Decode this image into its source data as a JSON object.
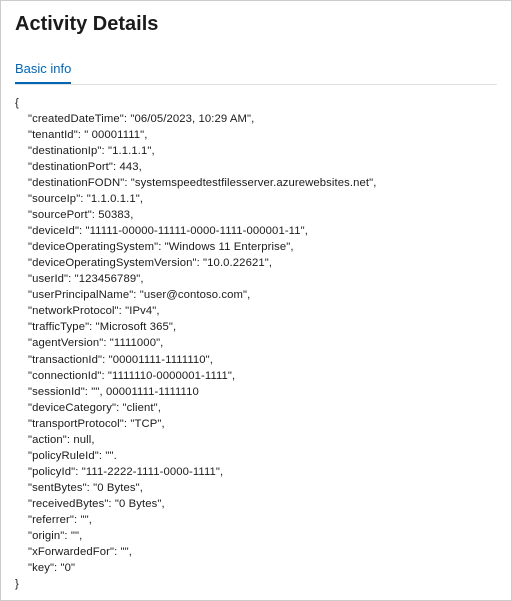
{
  "header": {
    "title": "Activity Details"
  },
  "tabs": [
    {
      "label": "Basic info"
    }
  ],
  "json_lines": [
    "{",
    "    \"createdDateTime\": \"06/05/2023, 10:29 AM\",",
    "    \"tenantId\": \" 00001111\",",
    "    \"destinationIp\": \"1.1.1.1\",",
    "    \"destinationPort\": 443,",
    "    \"destinationFODN\": \"systemspeedtestfilesserver.azurewebsites.net\",",
    "    \"sourceIp\": \"1.1.0.1.1\",",
    "    \"sourcePort\": 50383,",
    "    \"deviceId\": \"11111-00000-11111-0000-1111-000001-11\",",
    "    \"deviceOperatingSystem\": \"Windows 11 Enterprise\",",
    "    \"deviceOperatingSystemVersion\": \"10.0.22621\",",
    "    \"userId\": \"123456789\",",
    "    \"userPrincipalName\": \"user@contoso.com\",",
    "    \"networkProtocol\": \"IPv4\",",
    "    \"trafficType\": \"Microsoft 365\",",
    "    \"agentVersion\": \"1111000\",",
    "    \"transactionId\": \"00001111-1111110\",",
    "    \"connectionId\": \"1111110-0000001-1111\",",
    "    \"sessionId\": \"\", 00001111-1111110",
    "    \"deviceCategory\": \"client\",",
    "    \"transportProtocol\": \"TCP\",",
    "    \"action\": null,",
    "    \"policyRuleId\": \"\".",
    "    \"policyId\": \"111-2222-1111-0000-1111\",",
    "    \"sentBytes\": \"0 Bytes\",",
    "    \"receivedBytes\": \"0 Bytes\",",
    "    \"referrer\": \"\",",
    "    \"origin\": \"\",",
    "    \"xForwardedFor\": \"\",",
    "    \"key\": \"0\"",
    "}"
  ]
}
